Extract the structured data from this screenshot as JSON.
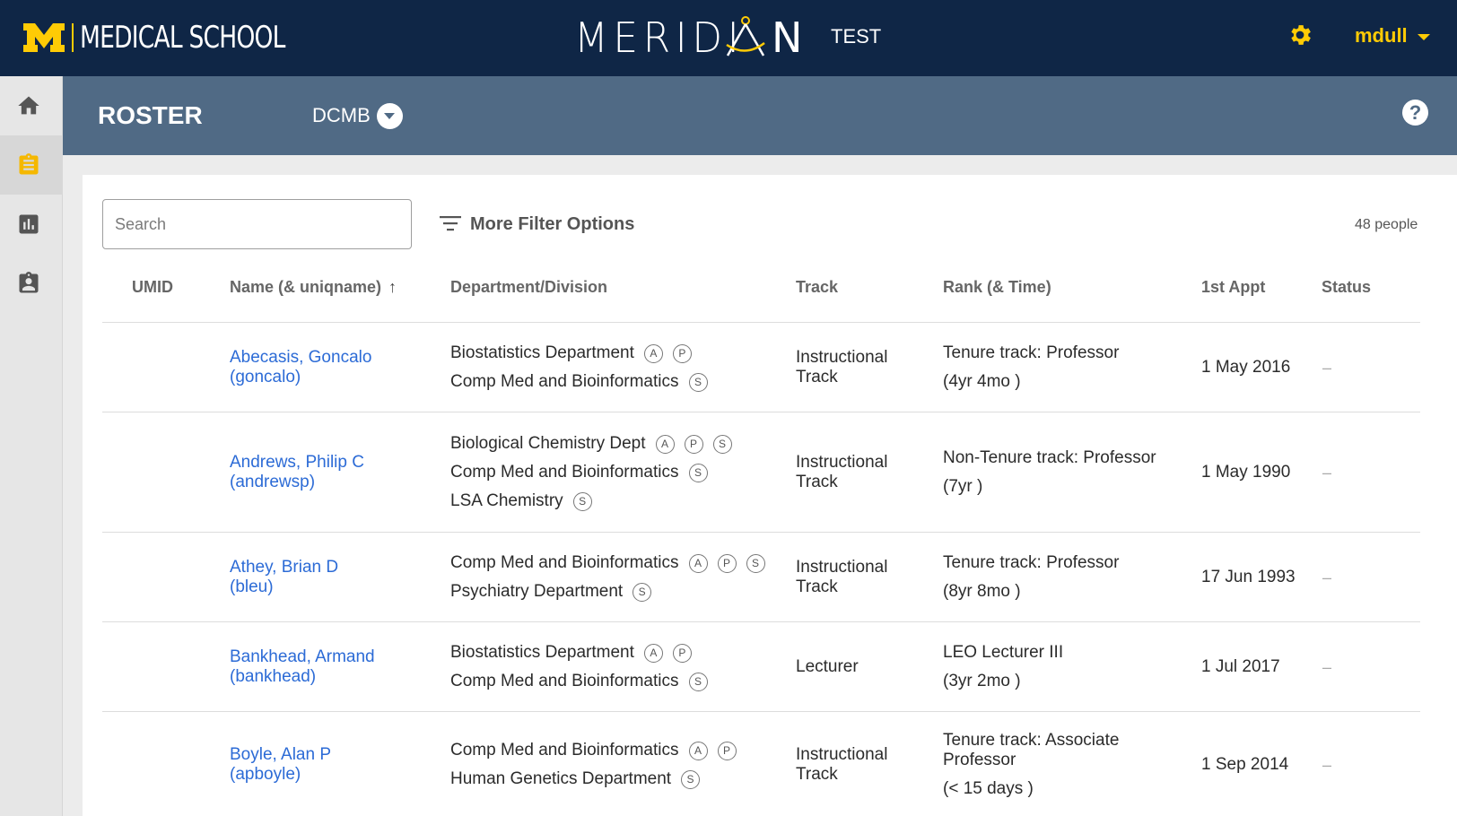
{
  "header": {
    "org_name": "MEDICAL SCHOOL",
    "app_name_left": "MERIDI",
    "app_name_right": "N",
    "env_label": "TEST",
    "username": "mdull",
    "colors": {
      "navy": "#0f2646",
      "maize": "#ffcb05",
      "slate": "#506a85"
    }
  },
  "rail": {
    "items": [
      {
        "icon": "home-icon",
        "active": false
      },
      {
        "icon": "clipboard-icon",
        "active": true
      },
      {
        "icon": "bar-chart-icon",
        "active": false
      },
      {
        "icon": "badge-icon",
        "active": false
      }
    ]
  },
  "subbar": {
    "title": "ROSTER",
    "department": "DCMB",
    "help_label": "?"
  },
  "toolbar": {
    "search_placeholder": "Search",
    "filter_label": "More Filter Options",
    "people_count": "48 people"
  },
  "table": {
    "columns": {
      "umid": "UMID",
      "name": "Name (& uniqname)",
      "department": "Department/Division",
      "track": "Track",
      "rank": "Rank (& Time)",
      "appt": "1st Appt",
      "status": "Status"
    },
    "rows": [
      {
        "name": "Abecasis, Goncalo",
        "uniqname": "(goncalo)",
        "departments": [
          {
            "name": "Biostatistics Department",
            "badges": [
              "A",
              "P"
            ]
          },
          {
            "name": "Comp Med and Bioinformatics",
            "badges": [
              "S"
            ]
          }
        ],
        "track": [
          "Instructional",
          "Track"
        ],
        "rank": [
          "Tenure track: Professor"
        ],
        "time": "(4yr 4mo )",
        "appt": "1 May 2016",
        "status": "–"
      },
      {
        "name": "Andrews, Philip C",
        "uniqname": "(andrewsp)",
        "departments": [
          {
            "name": "Biological Chemistry Dept",
            "badges": [
              "A",
              "P",
              "S"
            ]
          },
          {
            "name": "Comp Med and Bioinformatics",
            "badges": [
              "S"
            ]
          },
          {
            "name": "LSA Chemistry",
            "badges": [
              "S"
            ]
          }
        ],
        "track": [
          "Instructional",
          "Track"
        ],
        "rank": [
          "Non-Tenure track: Professor"
        ],
        "time": "(7yr )",
        "appt": "1 May 1990",
        "status": "–"
      },
      {
        "name": "Athey, Brian D",
        "uniqname": "(bleu)",
        "departments": [
          {
            "name": "Comp Med and Bioinformatics",
            "badges": [
              "A",
              "P",
              "S"
            ]
          },
          {
            "name": "Psychiatry Department",
            "badges": [
              "S"
            ]
          }
        ],
        "track": [
          "Instructional",
          "Track"
        ],
        "rank": [
          "Tenure track: Professor"
        ],
        "time": "(8yr 8mo )",
        "appt": "17 Jun 1993",
        "status": "–"
      },
      {
        "name": "Bankhead, Armand",
        "uniqname": "(bankhead)",
        "departments": [
          {
            "name": "Biostatistics Department",
            "badges": [
              "A",
              "P"
            ]
          },
          {
            "name": "Comp Med and Bioinformatics",
            "badges": [
              "S"
            ]
          }
        ],
        "track": [
          "Lecturer"
        ],
        "rank": [
          "LEO Lecturer III"
        ],
        "time": "(3yr 2mo )",
        "appt": "1 Jul 2017",
        "status": "–"
      },
      {
        "name": "Boyle, Alan P",
        "uniqname": "(apboyle)",
        "departments": [
          {
            "name": "Comp Med and Bioinformatics",
            "badges": [
              "A",
              "P"
            ]
          },
          {
            "name": "Human Genetics Department",
            "badges": [
              "S"
            ]
          }
        ],
        "track": [
          "Instructional",
          "Track"
        ],
        "rank": [
          "Tenure track: Associate",
          "Professor"
        ],
        "time": "(< 15 days )",
        "appt": "1 Sep 2014",
        "status": "–"
      }
    ]
  }
}
